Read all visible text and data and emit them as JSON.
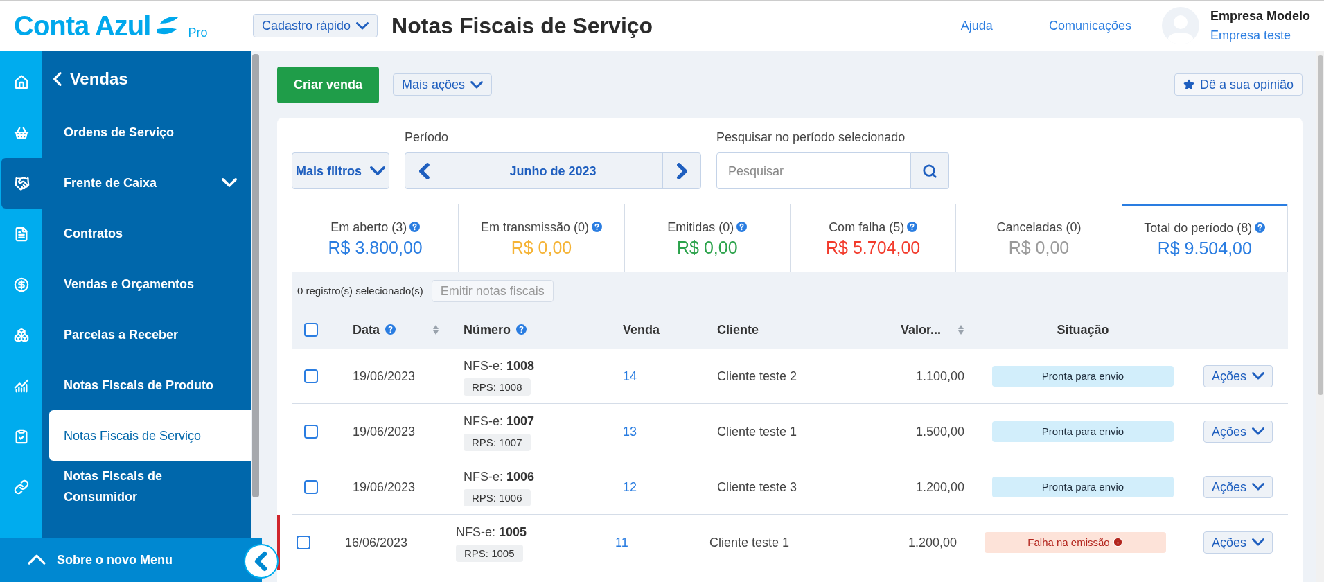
{
  "header": {
    "logo": "Conta Azul",
    "logo_badge": "Pro",
    "quick_add": "Cadastro rápido",
    "title": "Notas Fiscais de Serviço",
    "links": [
      "Ajuda",
      "Comunicações"
    ],
    "company": "Empresa Modelo",
    "user": "Empresa teste"
  },
  "rail": [
    {
      "kind": "home",
      "selected": false
    },
    {
      "kind": "basket",
      "selected": false
    },
    {
      "kind": "handshake",
      "selected": true
    },
    {
      "kind": "document",
      "selected": false
    },
    {
      "kind": "dollar",
      "selected": false
    },
    {
      "kind": "boxes",
      "selected": false
    },
    {
      "kind": "chart",
      "selected": false
    },
    {
      "kind": "clipboard",
      "selected": false
    },
    {
      "kind": "link",
      "selected": false
    }
  ],
  "submenu": {
    "title": "Vendas",
    "items": [
      {
        "label": "Ordens de Serviço",
        "selected": false,
        "expandable": false
      },
      {
        "label": "Frente de Caixa",
        "selected": false,
        "expandable": true
      },
      {
        "label": "Contratos",
        "selected": false,
        "expandable": false
      },
      {
        "label": "Vendas e Orçamentos",
        "selected": false,
        "expandable": false
      },
      {
        "label": "Parcelas a Receber",
        "selected": false,
        "expandable": false
      },
      {
        "label": "Notas Fiscais de Produto",
        "selected": false,
        "expandable": false
      },
      {
        "label": "Notas Fiscais de Serviço",
        "selected": true,
        "expandable": false
      },
      {
        "label": "Notas Fiscais de Consumidor",
        "selected": false,
        "expandable": false
      }
    ],
    "footer": "Sobre o novo Menu"
  },
  "toolbar": {
    "primary": "Criar venda",
    "more": "Mais ações",
    "feedback": "Dê a sua opinião"
  },
  "filters": {
    "more_filters": "Mais filtros",
    "period_label": "Período",
    "period": "Junho de 2023",
    "search_label": "Pesquisar no período selecionado",
    "search_placeholder": "Pesquisar"
  },
  "summary": [
    {
      "label": "Em aberto (3)",
      "amount": "R$ 3.800,00",
      "color": "#2a7de1",
      "help": true,
      "selected": false
    },
    {
      "label": "Em transmissão (0)",
      "amount": "R$ 0,00",
      "color": "#f5b335",
      "help": true,
      "selected": false
    },
    {
      "label": "Emitidas (0)",
      "amount": "R$ 0,00",
      "color": "#2aa24a",
      "help": true,
      "selected": false
    },
    {
      "label": "Com falha (5)",
      "amount": "R$ 5.704,00",
      "color": "#f23a2b",
      "help": true,
      "selected": false
    },
    {
      "label": "Canceladas (0)",
      "amount": "R$ 0,00",
      "color": "#9a9a9a",
      "help": false,
      "selected": false
    },
    {
      "label": "Total do período (8)",
      "amount": "R$ 9.504,00",
      "color": "#2a7de1",
      "help": true,
      "selected": true
    }
  ],
  "selection": {
    "count": "0 registro(s) selecionado(s)",
    "action": "Emitir notas fiscais"
  },
  "table": {
    "select_all_checked": false,
    "columns": [
      {
        "label": "Data",
        "help": true,
        "sortable": true
      },
      {
        "label": "Número",
        "help": true,
        "sortable": false
      },
      {
        "label": "Venda",
        "help": false,
        "sortable": false
      },
      {
        "label": "Cliente",
        "help": false,
        "sortable": false
      },
      {
        "label": "Valor...",
        "help": false,
        "sortable": true
      },
      {
        "label": "Situação",
        "help": false,
        "sortable": false
      }
    ],
    "rows": [
      {
        "date": "19/06/2023",
        "number_prefix": "NFS-e:",
        "number": "1008",
        "rps": "RPS: 1008",
        "sale": "14",
        "client": "Cliente teste 2",
        "value": "1.100,00",
        "status": {
          "label": "Pronta para envio",
          "kind": "ready"
        },
        "actions": "Ações",
        "checked": false
      },
      {
        "date": "19/06/2023",
        "number_prefix": "NFS-e:",
        "number": "1007",
        "rps": "RPS: 1007",
        "sale": "13",
        "client": "Cliente teste 1",
        "value": "1.500,00",
        "status": {
          "label": "Pronta para envio",
          "kind": "ready"
        },
        "actions": "Ações",
        "checked": false
      },
      {
        "date": "19/06/2023",
        "number_prefix": "NFS-e:",
        "number": "1006",
        "rps": "RPS: 1006",
        "sale": "12",
        "client": "Cliente teste 3",
        "value": "1.200,00",
        "status": {
          "label": "Pronta para envio",
          "kind": "ready"
        },
        "actions": "Ações",
        "checked": false
      },
      {
        "date": "16/06/2023",
        "number_prefix": "NFS-e:",
        "number": "1005",
        "rps": "RPS: 1005",
        "sale": "11",
        "client": "Cliente teste 1",
        "value": "1.200,00",
        "status": {
          "label": "Falha na emissão",
          "kind": "failed"
        },
        "actions": "Ações",
        "checked": false
      }
    ]
  }
}
